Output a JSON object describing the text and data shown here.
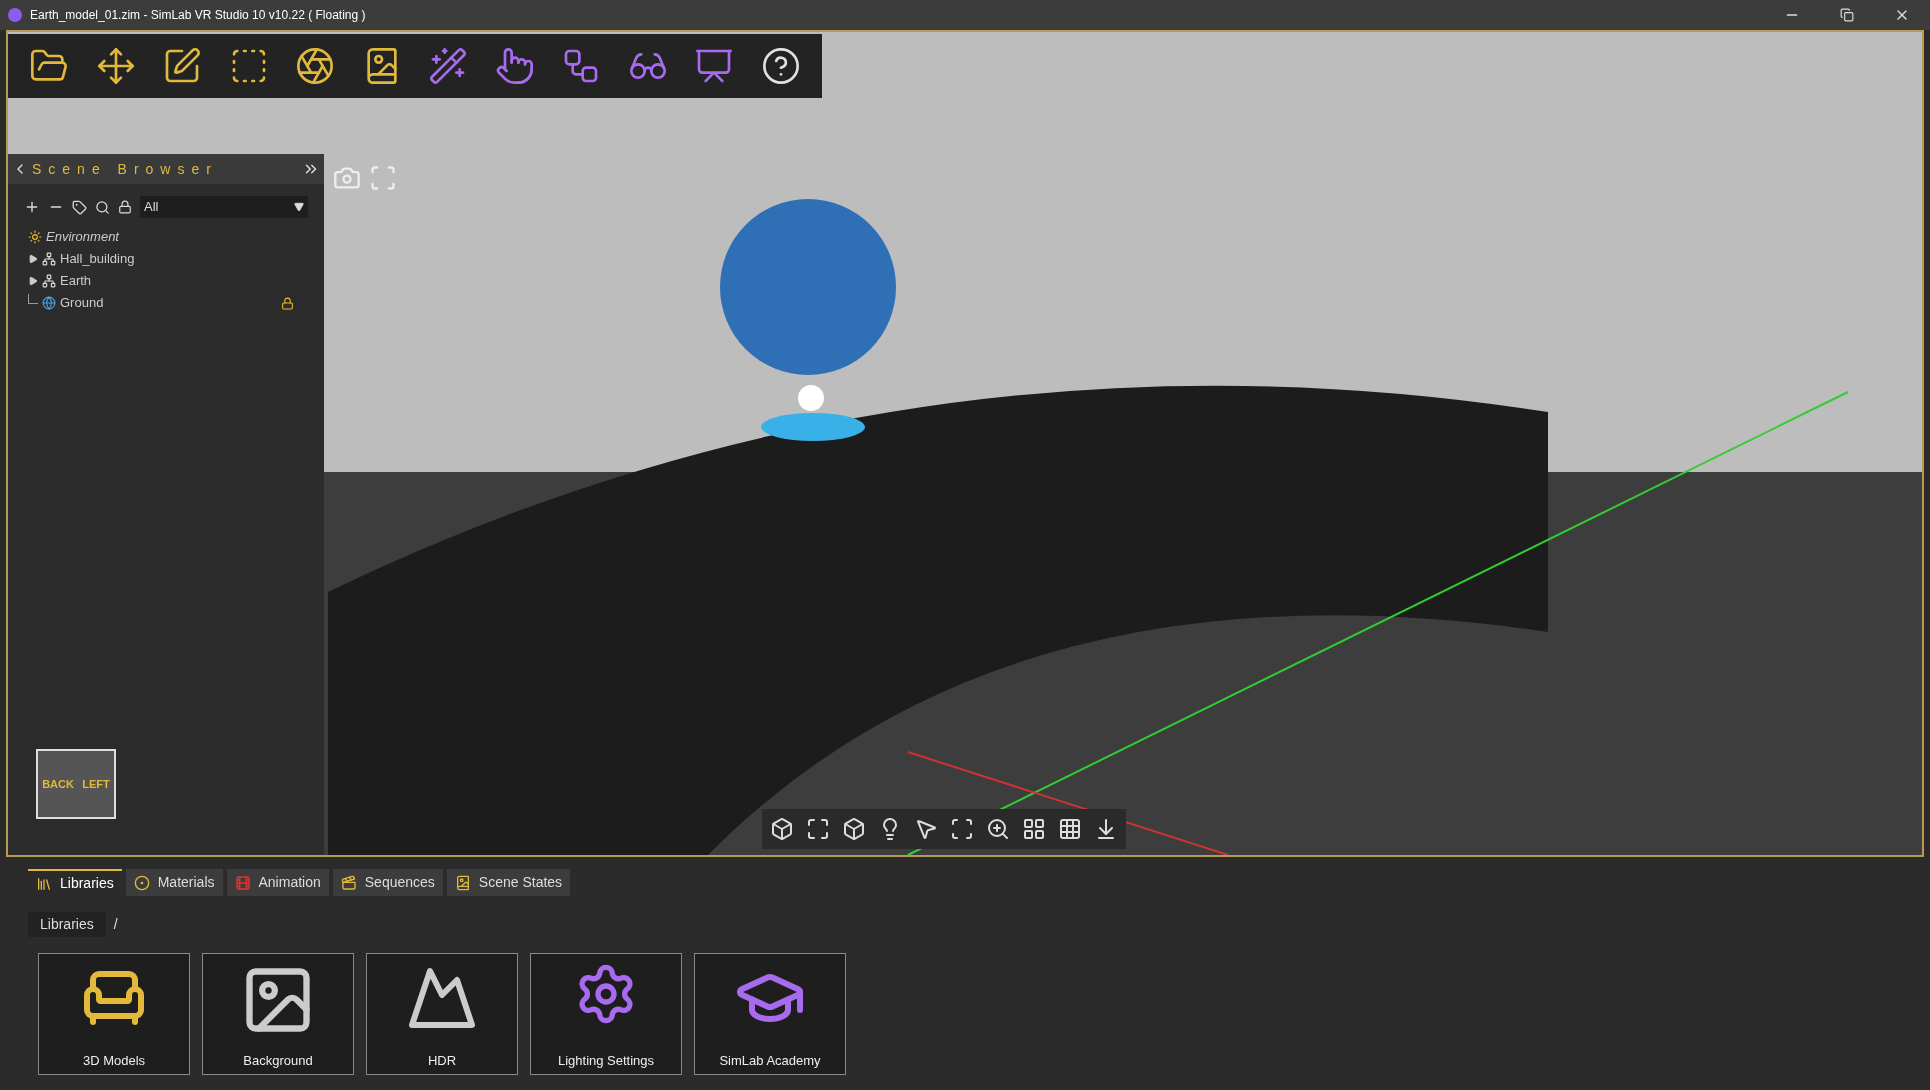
{
  "window": {
    "title": "Earth_model_01.zim - SimLab VR Studio 10 v10.22 ( Floating )"
  },
  "scene_browser": {
    "title": "Scene Browser",
    "filter": "All",
    "tree": [
      {
        "label": "Environment",
        "kind": "environment",
        "locked": false
      },
      {
        "label": "Hall_building",
        "kind": "group",
        "expanded": false,
        "locked": false
      },
      {
        "label": "Earth",
        "kind": "group",
        "expanded": false,
        "locked": false
      },
      {
        "label": "Ground",
        "kind": "leaf",
        "locked": true
      }
    ]
  },
  "view_cube": {
    "faces": [
      "BACK",
      "LEFT"
    ]
  },
  "bottom_tabs": [
    {
      "label": "Libraries",
      "kind": "libraries",
      "selected": true
    },
    {
      "label": "Materials",
      "kind": "materials",
      "selected": false
    },
    {
      "label": "Animation",
      "kind": "animation",
      "selected": false
    },
    {
      "label": "Sequences",
      "kind": "sequences",
      "selected": false
    },
    {
      "label": "Scene States",
      "kind": "states",
      "selected": false
    }
  ],
  "breadcrumb": {
    "label": "Libraries",
    "separator": "/"
  },
  "library_tiles": [
    {
      "label": "3D Models",
      "kind": "chair"
    },
    {
      "label": "Background",
      "kind": "background"
    },
    {
      "label": "HDR",
      "kind": "hdr"
    },
    {
      "label": "Lighting Settings",
      "kind": "lighting"
    },
    {
      "label": "SimLab Academy",
      "kind": "academy"
    }
  ]
}
